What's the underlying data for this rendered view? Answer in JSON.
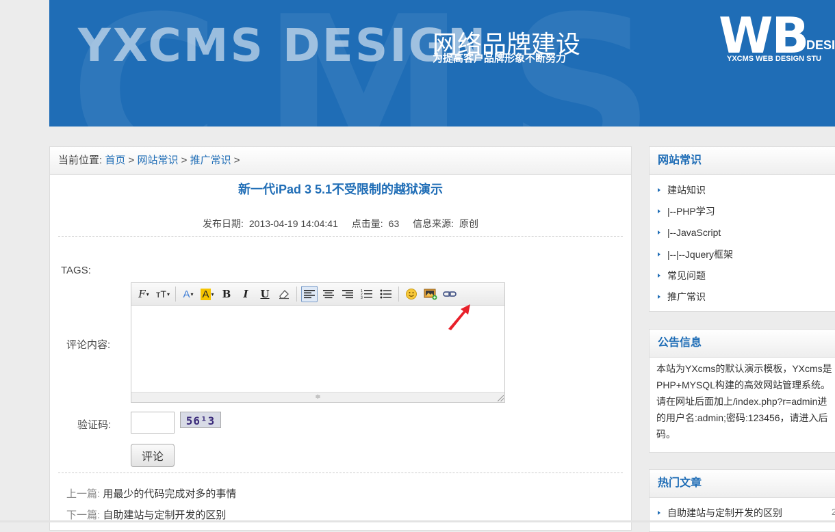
{
  "banner": {
    "brand_text": "YXCMS DESIGN",
    "cn_title": "网络品牌建设",
    "cn_subtitle": "为提高客户品牌形象不断努力",
    "logo_text": "WB",
    "logo_design": "DESI",
    "logo_sub": "YXCMS WEB DESIGN STU",
    "bg_letters": "CMS"
  },
  "breadcrumb": {
    "prefix": "当前位置:",
    "home": "首页",
    "sep1": ">",
    "category": "网站常识",
    "sep2": ">",
    "subcategory": "推广常识",
    "sep3": ">"
  },
  "article": {
    "title": "新一代iPad 3 5.1不受限制的越狱演示",
    "date_label": "发布日期:",
    "date": "2013-04-19 14:04:41",
    "views_label": "点击量:",
    "views": "63",
    "source_label": "信息来源:",
    "source": "原创",
    "tags_label": "TAGS:"
  },
  "comment": {
    "content_label": "评论内容:",
    "captcha_label": "验证码:",
    "captcha_text": "56¹3",
    "submit_label": "评论"
  },
  "editor_toolbar": {
    "buttons": [
      "font-family",
      "font-size",
      "font-color",
      "highlight",
      "bold",
      "italic",
      "underline",
      "clear-format",
      "align-left",
      "align-center",
      "align-right",
      "ordered-list",
      "unordered-list",
      "emoticon",
      "insert-image",
      "link"
    ],
    "bold_glyph": "B",
    "italic_glyph": "I",
    "underline_glyph": "U",
    "font_glyph": "F",
    "size_glyph": "тT",
    "color_glyph": "A",
    "highlight_glyph": "A",
    "resize_glyph": "≑"
  },
  "post_nav": {
    "prev_label": "上一篇:",
    "prev_title": "用最少的代码完成对多的事情",
    "next_label": "下一篇:",
    "next_title": "自助建站与定制开发的区别"
  },
  "sidebar": {
    "categories": {
      "title": "网站常识",
      "items": [
        "建站知识",
        "|--PHP学习",
        "|--JavaScript",
        "|--|--Jquery框架",
        "常见问题",
        "推广常识"
      ]
    },
    "notice": {
      "title": "公告信息",
      "lines": [
        "本站为YXcms的默认演示模板，YXcms是",
        "PHP+MYSQL构建的高效网站管理系统。",
        "请在网址后面加上/index.php?r=admin进",
        "的用户名:admin;密码:123456，请进入后",
        "码。"
      ]
    },
    "hot": {
      "title": "热门文章",
      "items": [
        "自助建站与定制开发的区别"
      ],
      "right_text": "2"
    }
  },
  "colors": {
    "accent": "#1f6db6",
    "arrow": "#e8202a",
    "background": "#ececec"
  }
}
